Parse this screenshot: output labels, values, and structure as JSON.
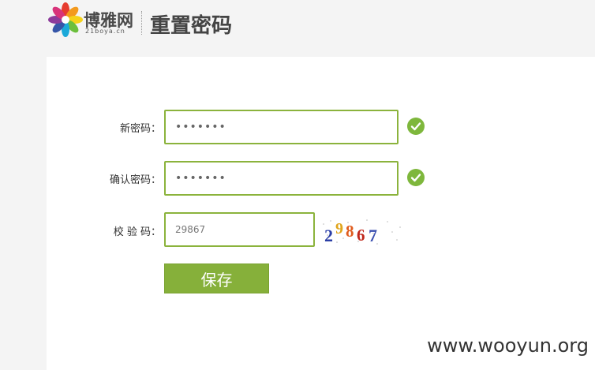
{
  "header": {
    "logo_text": "博雅网",
    "logo_sub": "21boya.cn",
    "page_title": "重置密码"
  },
  "form": {
    "new_password_label": "新密码：",
    "new_password_value": "•••••••",
    "confirm_password_label": "确认密码：",
    "confirm_password_value": "•••••••",
    "captcha_label": "校 验 码：",
    "captcha_input_value": "29867",
    "captcha_image_text": "29867",
    "save_label": "保存"
  },
  "watermark": "www.wooyun.org",
  "colors": {
    "accent": "#86b03a",
    "check": "#7eb73c"
  },
  "icons": {
    "new_password_status": "check-circle-icon",
    "confirm_password_status": "check-circle-icon"
  }
}
